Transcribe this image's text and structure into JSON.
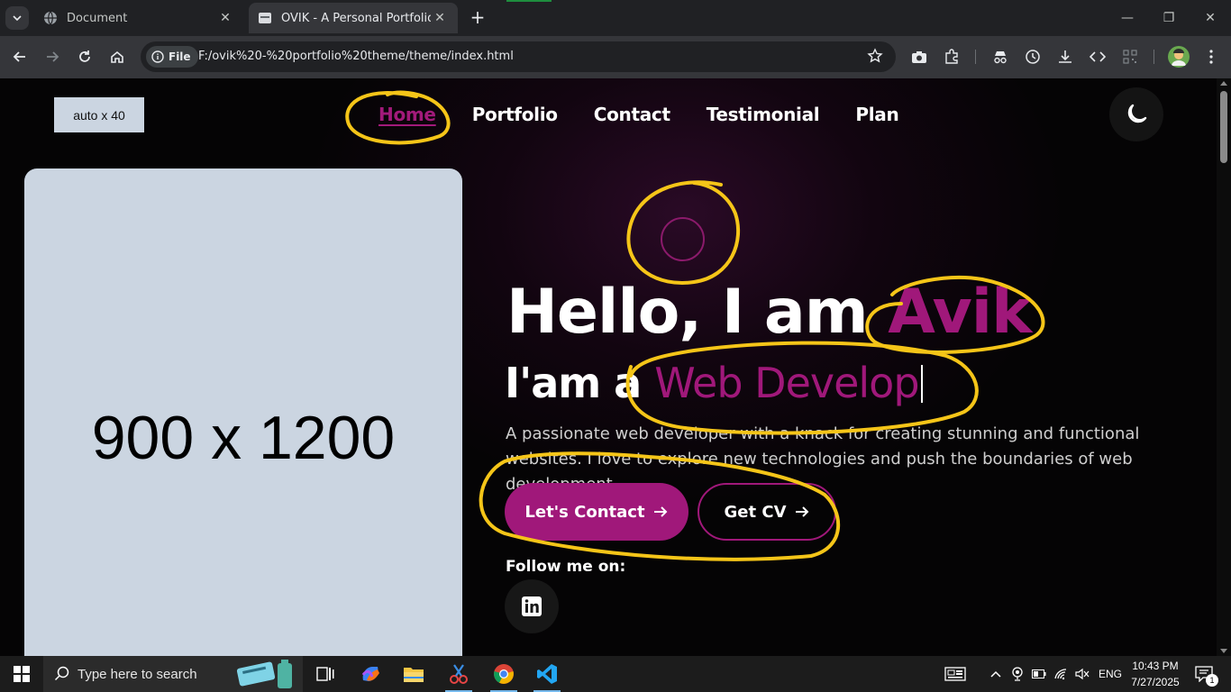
{
  "browser": {
    "tabs": [
      {
        "title": "Document",
        "active": false
      },
      {
        "title": "OVIK - A Personal Portfolio Tem",
        "active": true
      }
    ],
    "omnibox": {
      "chip_label": "File",
      "url": "F:/ovik%20-%20portfolio%20theme/theme/index.html"
    }
  },
  "header": {
    "logo_placeholder": "auto x 40",
    "nav": [
      "Home",
      "Portfolio",
      "Contact",
      "Testimonial",
      "Plan"
    ],
    "active_nav": "Home",
    "theme_toggle_icon": "moon-icon"
  },
  "hero": {
    "image_placeholder": "900 x 1200",
    "greeting": "Hello, I am ",
    "name": "Avik",
    "role_prefix": "I'am a ",
    "role": "Web Develop",
    "description": "A passionate web developer with a knack for creating stunning and functional websites. I love to explore new technologies and push the boundaries of web development.",
    "buttons": {
      "contact": "Let's Contact",
      "cv": "Get CV"
    },
    "follow_label": "Follow me on:",
    "social_icons": [
      "linkedin-icon"
    ]
  },
  "colors": {
    "accent": "#a0187a",
    "annotation": "#f5c518",
    "placeholder": "#cbd5e1"
  },
  "taskbar": {
    "search_placeholder": "Type here to search",
    "language": "ENG",
    "time": "10:43 PM",
    "date": "7/27/2025",
    "notifications": "1"
  }
}
